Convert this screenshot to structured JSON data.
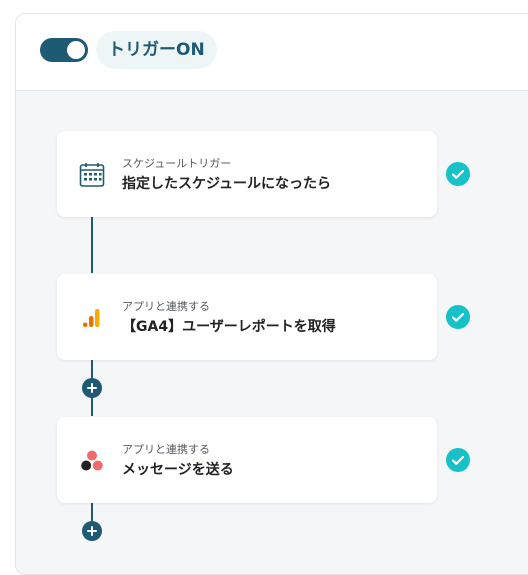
{
  "header": {
    "toggle_state": "on",
    "trigger_label": "トリガーON"
  },
  "steps": [
    {
      "category": "スケジュールトリガー",
      "title": "指定したスケジュールになったら",
      "icon": "calendar-icon",
      "status": "complete"
    },
    {
      "category": "アプリと連携する",
      "title": "【GA4】ユーザーレポートを取得",
      "icon": "google-analytics-icon",
      "status": "complete"
    },
    {
      "category": "アプリと連携する",
      "title": "メッセージを送る",
      "icon": "asana-icon",
      "status": "complete"
    }
  ],
  "colors": {
    "accent": "#1e5a73",
    "check": "#17c1c8",
    "ga_orange": "#f9ab00",
    "ga_dark_orange": "#e37400",
    "asana_red": "#f06a6a"
  }
}
